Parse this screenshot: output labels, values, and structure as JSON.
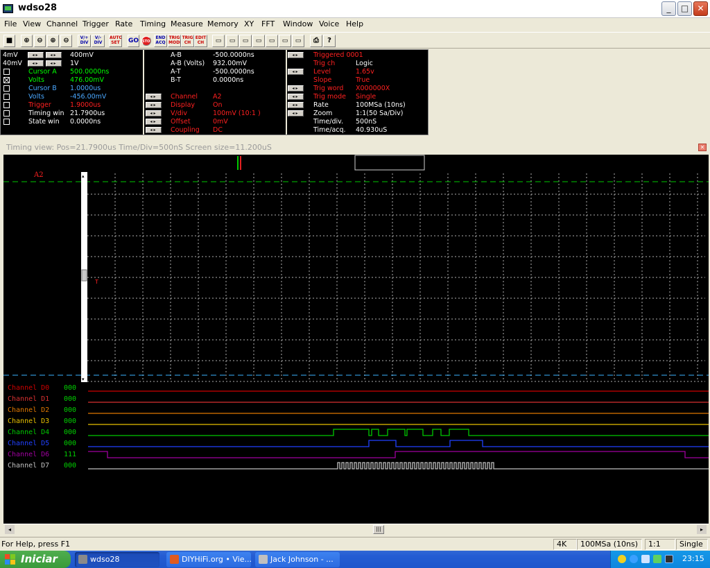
{
  "window": {
    "title": "wdso28",
    "min": "_",
    "max": "□",
    "close": "✕"
  },
  "menu": [
    "File",
    "View",
    "Channel",
    "Trigger",
    "Rate",
    "Timing",
    "Measure",
    "Memory",
    "XY",
    "FFT",
    "Window",
    "Voice",
    "Help"
  ],
  "toolbar": {
    "volt_up": "V/+\nDIV",
    "volt_down": "V/-\nDIV",
    "auto_set": "AUTO\nSET",
    "go": "GO",
    "stop": "STOP",
    "end_acq": "END\nACQ",
    "trig_mode": "TRIG\nMODE",
    "trig_ch": "TRIG\nCH",
    "edit_ch": "EDIT\nCH"
  },
  "left_panel": {
    "r1": {
      "a": "4mV",
      "v": "400mV"
    },
    "r2": {
      "a": "40mV",
      "v": "1V"
    },
    "rows": [
      {
        "label": "Cursor A",
        "value": "500.0000ns",
        "color": "#00ff00",
        "checked": false
      },
      {
        "label": "Volts",
        "value": "476.00mV",
        "color": "#00ff00",
        "checked": true
      },
      {
        "label": "Cursor B",
        "value": "1.0000us",
        "color": "#4aa8ff",
        "checked": false
      },
      {
        "label": "Volts",
        "value": "-456.00mV",
        "color": "#4aa8ff",
        "checked": false
      },
      {
        "label": "Trigger",
        "value": "1.9000us",
        "color": "#ff2020",
        "checked": false
      },
      {
        "label": "Timing win",
        "value": "21.7900us",
        "color": "#ffffff",
        "checked": false
      },
      {
        "label": "State win",
        "value": "0.0000ns",
        "color": "#ffffff",
        "checked": false
      }
    ]
  },
  "mid_panel": {
    "rows": [
      {
        "label": "A-B",
        "value": "-500.0000ns",
        "color": "#ffffff"
      },
      {
        "label": "A-B (Volts)",
        "value": "932.00mV",
        "color": "#ffffff"
      },
      {
        "label": "A-T",
        "value": "-500.0000ns",
        "color": "#ffffff"
      },
      {
        "label": "B-T",
        "value": "0.0000ns",
        "color": "#ffffff"
      },
      {
        "label": "Channel",
        "value": "A2",
        "color": "#ff2020"
      },
      {
        "label": "Display",
        "value": "On",
        "color": "#ff2020"
      },
      {
        "label": "V/div",
        "value": "100mV (10:1  )",
        "color": "#ff2020"
      },
      {
        "label": "Offset",
        "value": "0mV",
        "color": "#ff2020"
      },
      {
        "label": "Coupling",
        "value": "DC",
        "color": "#ff2020"
      }
    ]
  },
  "right_panel": {
    "rows": [
      {
        "label": "Triggered 0001",
        "value": "",
        "color": "#ff2020"
      },
      {
        "label": "Trig ch",
        "value": "Logic",
        "color": "#ff2020",
        "vcolor": "#ffffff"
      },
      {
        "label": "Level",
        "value": "1.65v",
        "color": "#ff2020",
        "vcolor": "#ff2020"
      },
      {
        "label": "Slope",
        "value": "True",
        "color": "#ff2020",
        "vcolor": "#ff2020"
      },
      {
        "label": "Trig word",
        "value": "X000000X",
        "color": "#ff2020",
        "vcolor": "#ff2020"
      },
      {
        "label": "Trig mode",
        "value": "Single",
        "color": "#ff2020",
        "vcolor": "#ff2020"
      },
      {
        "label": "Rate",
        "value": "100MSa (10ns)",
        "color": "#ffffff",
        "vcolor": "#ffffff"
      },
      {
        "label": "Zoom",
        "value": "1:1(50 Sa/Div)",
        "color": "#ffffff",
        "vcolor": "#ffffff"
      },
      {
        "label": "Time/div.",
        "value": "500nS",
        "color": "#ffffff",
        "vcolor": "#ffffff"
      },
      {
        "label": "Time/acq.",
        "value": "40.930uS",
        "color": "#ffffff",
        "vcolor": "#ffffff"
      }
    ]
  },
  "timing_view": {
    "title": "Timing view: Pos=21.7900us Time/Div=500nS Screen size=11.200uS",
    "channel_marker": "A2",
    "trigger_marker": "T",
    "colors": {
      "cursor_a": "#00c800",
      "cursor_b": "#3ab4ff",
      "grid": "#b0b0b0"
    }
  },
  "digital_channels": [
    {
      "label": "Channel D0",
      "value": "000",
      "color": "#d00000",
      "vcolor": "#00d000"
    },
    {
      "label": "Channel D1",
      "value": "000",
      "color": "#d83030",
      "vcolor": "#00d000"
    },
    {
      "label": "Channel D2",
      "value": "000",
      "color": "#e07800",
      "vcolor": "#00d000"
    },
    {
      "label": "Channel D3",
      "value": "000",
      "color": "#e8c000",
      "vcolor": "#00d000"
    },
    {
      "label": "Channel D4",
      "value": "000",
      "color": "#00c800",
      "vcolor": "#00d000"
    },
    {
      "label": "Channel D5",
      "value": "000",
      "color": "#2040ff",
      "vcolor": "#00d000"
    },
    {
      "label": "Channel D6",
      "value": "111",
      "color": "#a000a0",
      "vcolor": "#00d000"
    },
    {
      "label": "Channel D7",
      "value": "000",
      "color": "#c0c0c0",
      "vcolor": "#00d000"
    }
  ],
  "status": {
    "help": "For Help, press F1",
    "mem": "4K",
    "rate": "100MSa (10ns)",
    "zoom": "1:1",
    "mode": "Single"
  },
  "taskbar": {
    "start": "Iniciar",
    "tasks": [
      {
        "label": "wdso28",
        "active": true
      },
      {
        "label": "DIYHiFi.org • Vie...",
        "active": false
      },
      {
        "label": "Jack Johnson - ...",
        "active": false
      }
    ],
    "clock": "23:15"
  }
}
